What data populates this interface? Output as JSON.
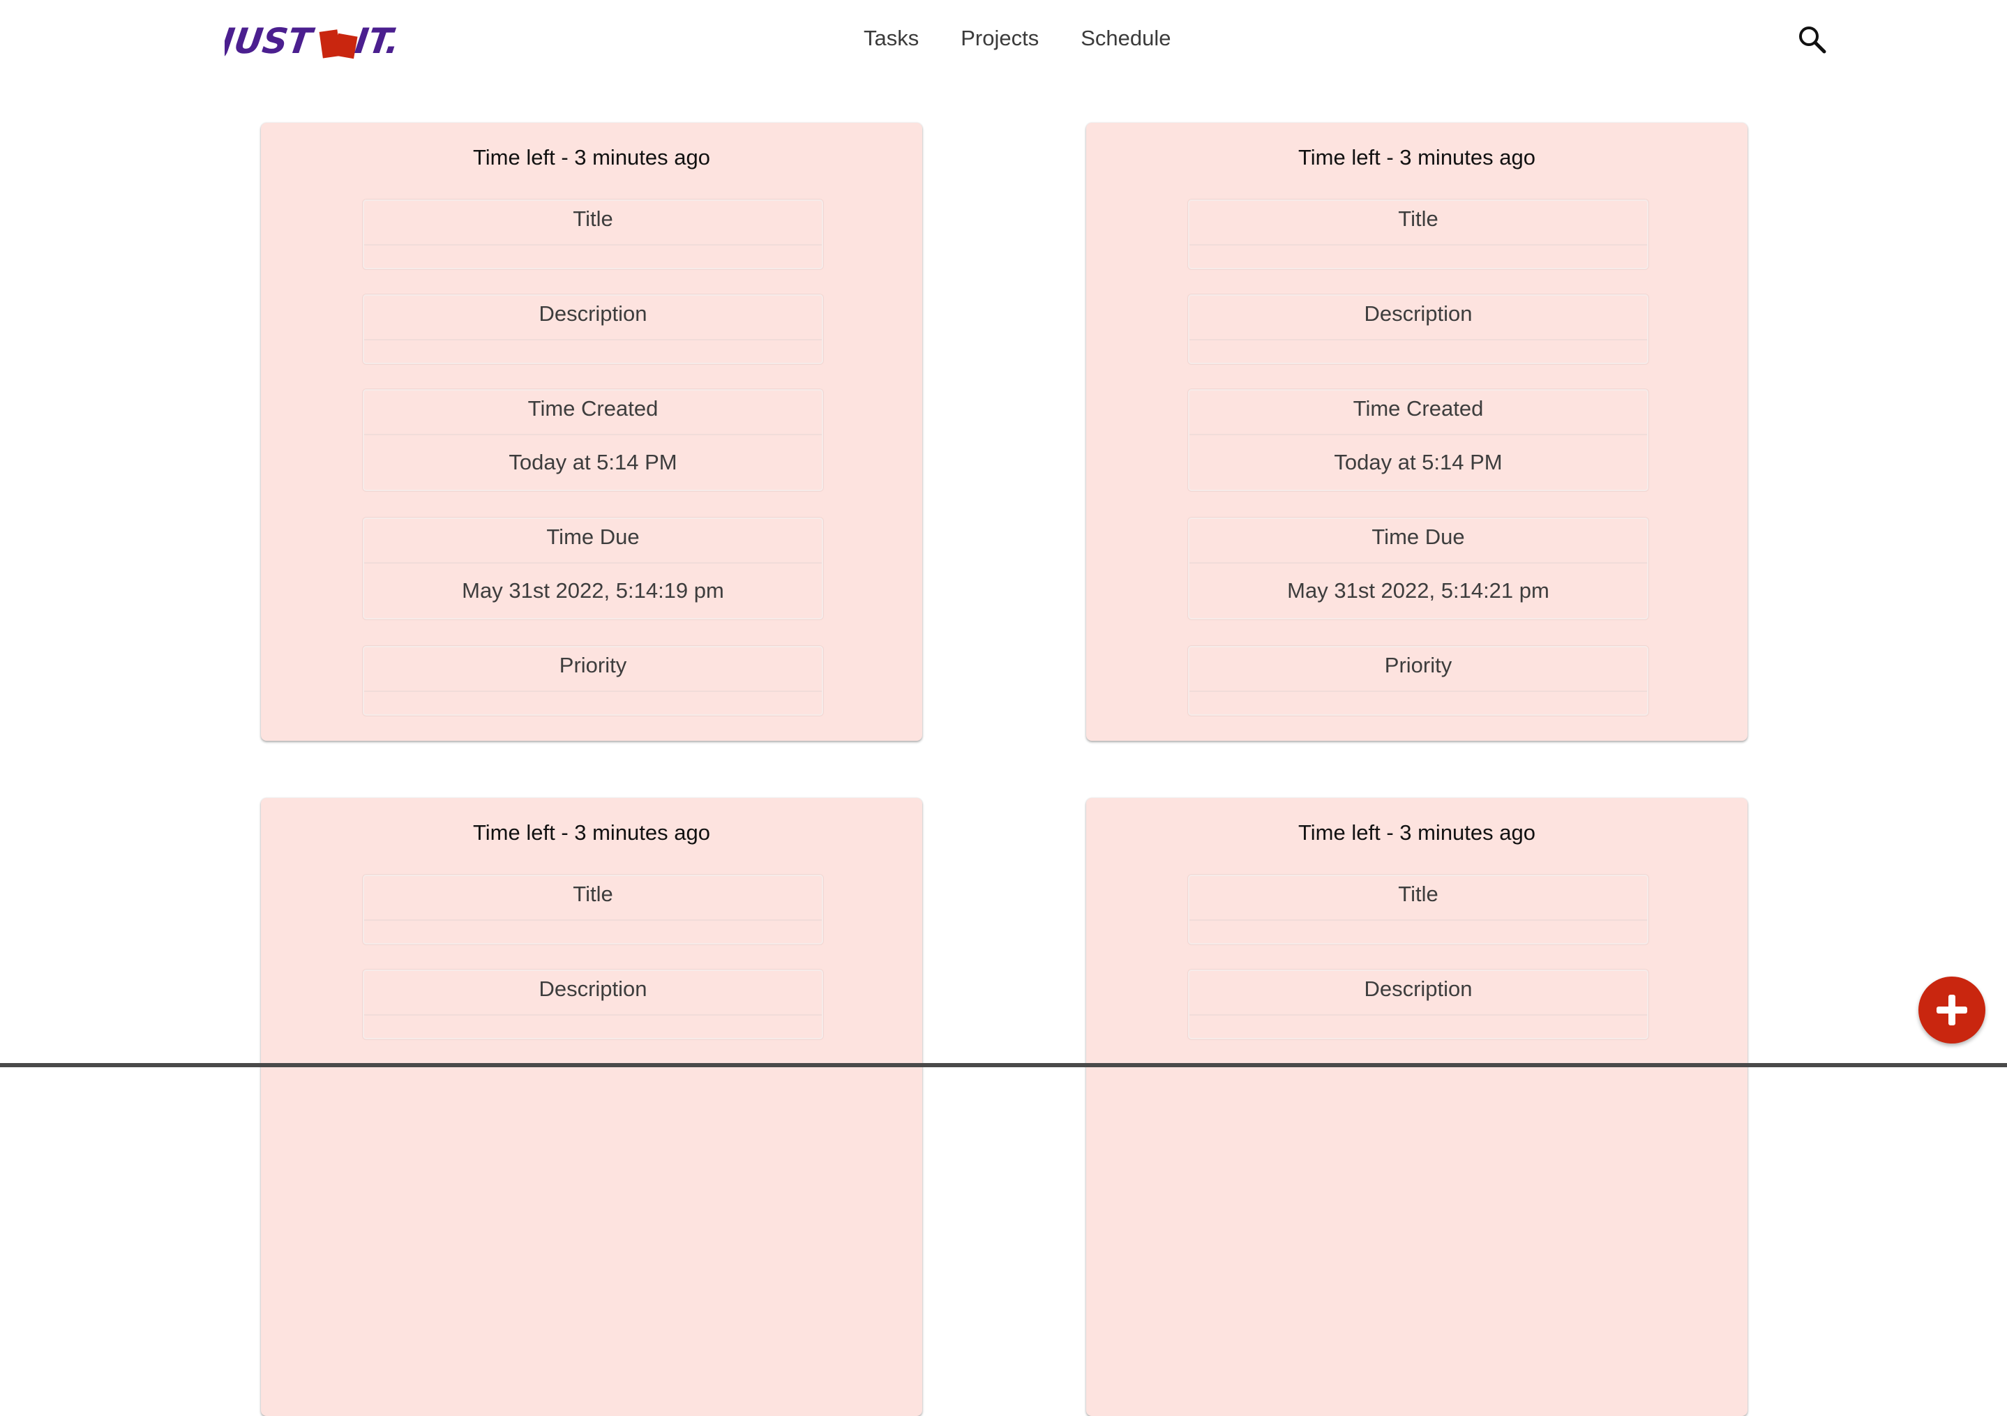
{
  "brand": {
    "logo_text": "JUSTdoIT.",
    "colors": {
      "purple": "#4b1f8f",
      "red": "#c9260f"
    }
  },
  "nav": {
    "items": [
      {
        "label": "Tasks"
      },
      {
        "label": "Projects"
      },
      {
        "label": "Schedule"
      }
    ],
    "search_icon": "search-icon"
  },
  "task_labels": {
    "title": "Title",
    "description": "Description",
    "time_created": "Time Created",
    "time_due": "Time Due",
    "priority": "Priority"
  },
  "tasks": [
    {
      "time_left": "Time left - 3 minutes ago",
      "title": "",
      "description": "",
      "time_created": "Today at 5:14 PM",
      "time_due": "May 31st 2022, 5:14:19 pm",
      "priority": ""
    },
    {
      "time_left": "Time left - 3 minutes ago",
      "title": "",
      "description": "",
      "time_created": "Today at 5:14 PM",
      "time_due": "May 31st 2022, 5:14:21 pm",
      "priority": ""
    },
    {
      "time_left": "Time left - 3 minutes ago",
      "title": "",
      "description": ""
    },
    {
      "time_left": "Time left - 3 minutes ago",
      "title": "",
      "description": ""
    }
  ],
  "card_color": "#fde3df",
  "fab": {
    "icon": "plus-icon",
    "color": "#c9260f"
  }
}
